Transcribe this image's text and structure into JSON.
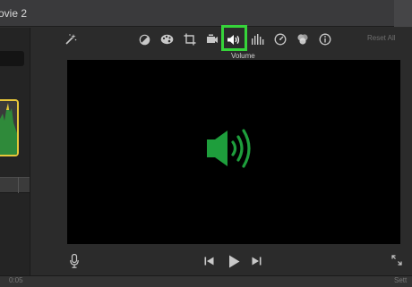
{
  "window": {
    "title": "ovie 2"
  },
  "toolbar": {
    "tools": [
      "magic-wand",
      "color-balance",
      "color-correction",
      "crop",
      "stabilization",
      "volume",
      "noise-reduction",
      "speed",
      "clip-filter",
      "info"
    ],
    "reset_label": "Reset All",
    "tooltip": "Volume"
  },
  "left_panel": {
    "row_value": ""
  },
  "bottom": {
    "left_text": "0:05",
    "right_text": "Sett"
  },
  "colors": {
    "highlight": "#36d43a",
    "speaker": "#1e9e3c",
    "thumb_border": "#e7c73a"
  }
}
